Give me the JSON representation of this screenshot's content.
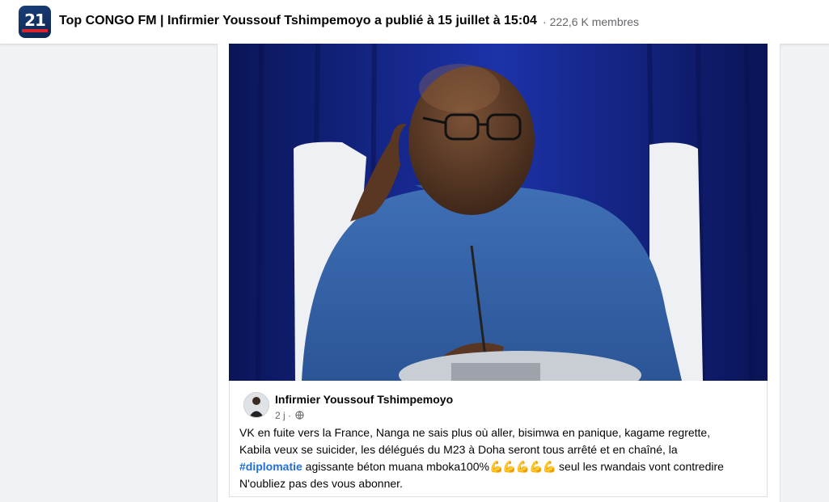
{
  "header": {
    "logo_text": "21",
    "title": "Top CONGO FM | Infirmier Youssouf Tshimpemoyo a publié à 15 juillet à 15:04",
    "separator": "·",
    "members": "222,6 K membres"
  },
  "post": {
    "photo_alt": "Photo of a man in a blue shirt seated at a microphone",
    "author": "Infirmier Youssouf Tshimpemoyo",
    "time": "2 j",
    "dot": "·",
    "text_line1": "VK en fuite vers la France, Nanga ne sais plus où aller, bisimwa en panique, kagame regrette,",
    "text_line2": "Kabila veux se suicider, les délégués du M23 à Doha seront tous arrêté et en chaîné, la",
    "hashtag": "#diplomatie",
    "text_line3_rest": " agissante béton muana mboka100%",
    "emojis": "💪💪💪💪💪",
    "text_line3_end": " seul les rwandais vont contredire",
    "text_line4": "N'oubliez pas des vous abonner."
  },
  "colors": {
    "background": "#f0f2f5",
    "hashtag": "#216fdb",
    "photo_bg": "#13247f"
  }
}
